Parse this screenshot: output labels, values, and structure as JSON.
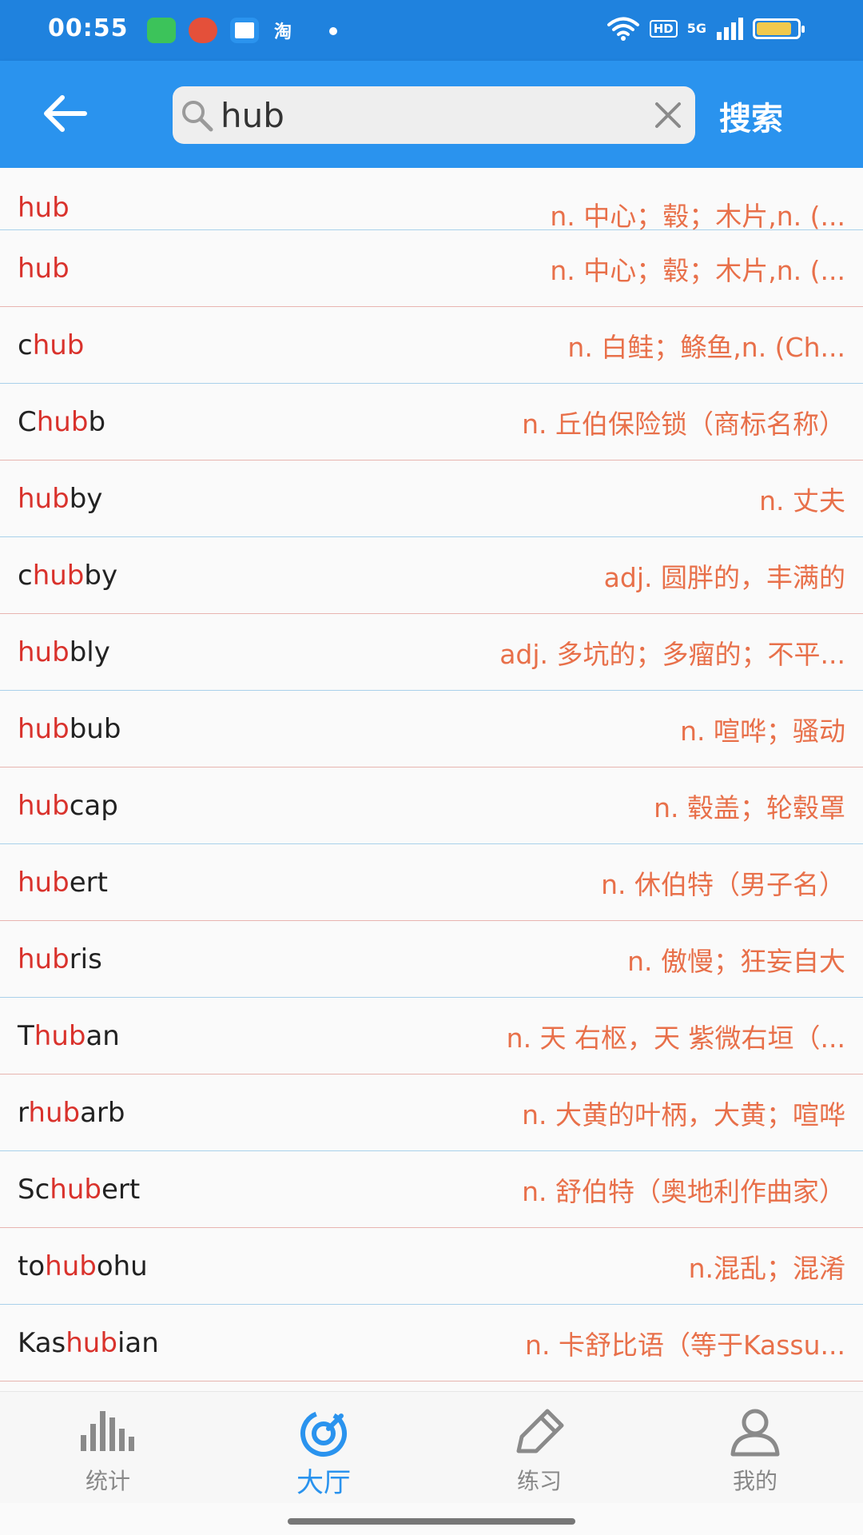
{
  "status_bar": {
    "time": "00:55",
    "app_tao_label": "淘",
    "network_hd": "HD",
    "network_5g": "5G",
    "battery_fill_pct": 85
  },
  "search": {
    "query": "hub",
    "button_label": "搜索"
  },
  "results": [
    {
      "pre": "",
      "hl": "hub",
      "post": "",
      "meaning": "n. 中心；毂；木片,n. (..."
    },
    {
      "pre": "",
      "hl": "hub",
      "post": "",
      "meaning": "n. 中心；毂；木片,n. (..."
    },
    {
      "pre": "c",
      "hl": "hub",
      "post": "",
      "meaning": "n. 白鲑；鲦鱼,n. (Ch..."
    },
    {
      "pre": "C",
      "hl": "hub",
      "post": "b",
      "meaning": "n. 丘伯保险锁（商标名称）"
    },
    {
      "pre": "",
      "hl": "hub",
      "post": "by",
      "meaning": "n. 丈夫"
    },
    {
      "pre": "c",
      "hl": "hub",
      "post": "by",
      "meaning": "adj. 圆胖的，丰满的"
    },
    {
      "pre": "",
      "hl": "hub",
      "post": "bly",
      "meaning": "adj. 多坑的；多瘤的；不平..."
    },
    {
      "pre": "",
      "hl": "hub",
      "post": "bub",
      "meaning": "n. 喧哗；骚动"
    },
    {
      "pre": "",
      "hl": "hub",
      "post": "cap",
      "meaning": "n. 毂盖；轮毂罩"
    },
    {
      "pre": "",
      "hl": "hub",
      "post": "ert",
      "meaning": "n. 休伯特（男子名）"
    },
    {
      "pre": "",
      "hl": "hub",
      "post": "ris",
      "meaning": "n. 傲慢；狂妄自大"
    },
    {
      "pre": "T",
      "hl": "hub",
      "post": "an",
      "meaning": "n. 天 右枢，天 紫微右垣（..."
    },
    {
      "pre": "r",
      "hl": "hub",
      "post": "arb",
      "meaning": "n. 大黄的叶柄，大黄；喧哗"
    },
    {
      "pre": "Sc",
      "hl": "hub",
      "post": "ert",
      "meaning": "n. 舒伯特（奥地利作曲家）"
    },
    {
      "pre": "to",
      "hl": "hub",
      "post": "ohu",
      "meaning": "n.混乱；混淆"
    },
    {
      "pre": "Kas",
      "hl": "hub",
      "post": "ian",
      "meaning": "n. 卡舒比语（等于Kassu..."
    }
  ],
  "bottom_nav": {
    "stats": "统计",
    "hall": "大厅",
    "practice": "练习",
    "mine": "我的"
  },
  "colors": {
    "primary": "#2a93ee",
    "highlight": "#d9322c",
    "meaning": "#e8704a"
  }
}
